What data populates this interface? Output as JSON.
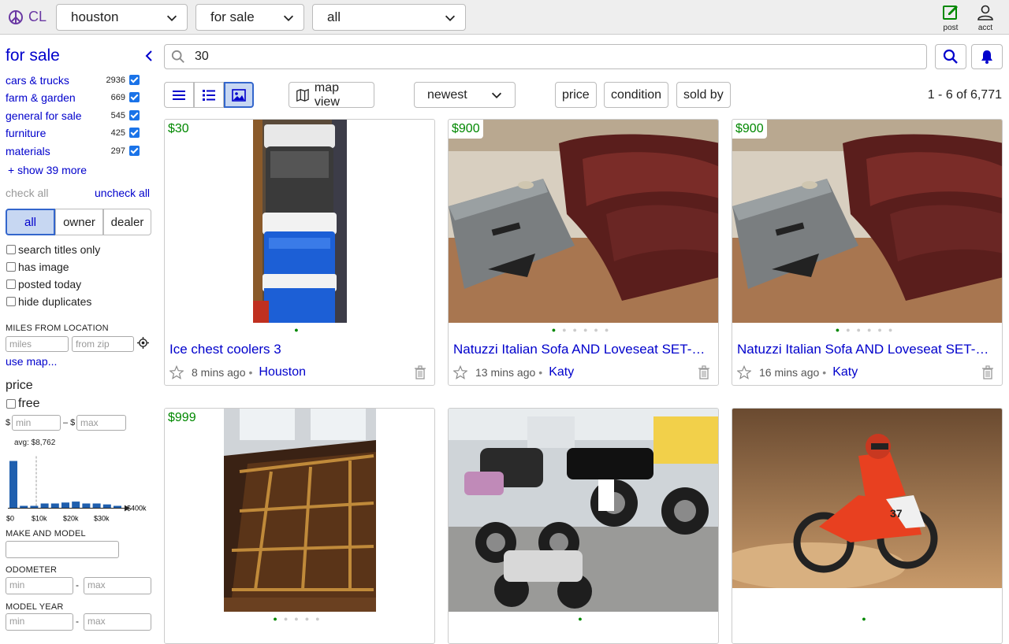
{
  "header": {
    "logo_text": "CL",
    "location": "houston",
    "category": "for sale",
    "subcategory": "all",
    "post_label": "post",
    "acct_label": "acct"
  },
  "sidebar": {
    "title": "for sale",
    "categories": [
      {
        "name": "cars & trucks",
        "count": "2936"
      },
      {
        "name": "farm & garden",
        "count": "669"
      },
      {
        "name": "general for sale",
        "count": "545"
      },
      {
        "name": "furniture",
        "count": "425"
      },
      {
        "name": "materials",
        "count": "297"
      }
    ],
    "show_more": "+ show 39 more",
    "check_all": "check all",
    "uncheck_all": "uncheck all",
    "seller_types": [
      "all",
      "owner",
      "dealer"
    ],
    "options": [
      "search titles only",
      "has image",
      "posted today",
      "hide duplicates"
    ],
    "miles_label": "MILES FROM LOCATION",
    "miles_placeholder": "miles",
    "zip_placeholder": "from zip",
    "use_map": "use map...",
    "price_heading": "price",
    "free_label": "free",
    "dollar": "$",
    "dash_dollar": "– $",
    "min_placeholder": "min",
    "max_placeholder": "max",
    "avg_label": "avg: $8,762",
    "hist_ticks": [
      "$0",
      "$10k",
      "$20k",
      "$30k"
    ],
    "hist_max_label": "$400k",
    "hist_values": [
      1.0,
      0.05,
      0.05,
      0.1,
      0.1,
      0.12,
      0.14,
      0.1,
      0.1,
      0.08,
      0.05
    ],
    "make_model_label": "MAKE AND MODEL",
    "odometer_label": "ODOMETER",
    "model_year_label": "MODEL YEAR",
    "range_dash": "-"
  },
  "search": {
    "query": "30"
  },
  "toolbar": {
    "map_view": "map view",
    "sort": "newest",
    "price": "price",
    "condition": "condition",
    "sold_by": "sold by",
    "result_count": "1 - 6 of 6,771"
  },
  "listings": [
    {
      "price": "$30",
      "title": "Ice chest coolers 3",
      "time": "8 mins ago",
      "location": "Houston"
    },
    {
      "price": "$900",
      "title": "Natuzzi Italian Sofa AND Loveseat SET-Deep Burgundy Leather",
      "time": "13 mins ago",
      "location": "Katy"
    },
    {
      "price": "$900",
      "title": "Natuzzi Italian Sofa AND Loveseat SET-Deep Burgundy Leather",
      "time": "16 mins ago",
      "location": "Katy"
    },
    {
      "price": "$999",
      "title": "",
      "time": "",
      "location": ""
    },
    {
      "price": "",
      "title": "",
      "time": "",
      "location": ""
    },
    {
      "price": "",
      "title": "",
      "time": "",
      "location": ""
    }
  ]
}
